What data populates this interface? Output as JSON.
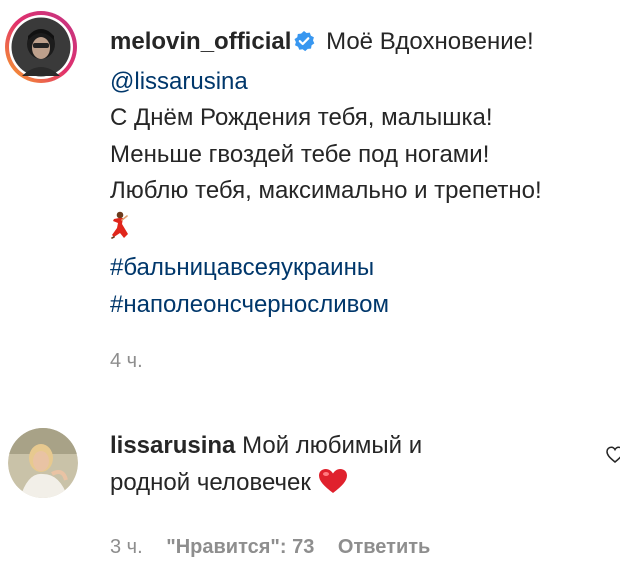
{
  "post": {
    "username": "melovin_official",
    "caption_title": "Моё Вдохновение!",
    "mention": "@lissarusina",
    "lines": [
      "С Днём Рождения тебя, малышка!",
      "Меньше гвоздей тебе под ногами!",
      "Люблю тебя, максимально и трепетно!"
    ],
    "emoji_icon": "dancer-emoji-icon",
    "hashtags": [
      "#бальницавсеяукраины",
      "#наполеонсчерносливом"
    ],
    "time": "4 ч."
  },
  "reply": {
    "username": "lissarusina",
    "text_line1": "Мой любимый и",
    "text_line2": "родной человечек",
    "emoji_icon": "red-heart-emoji-icon",
    "time": "3 ч.",
    "likes": "\"Нравится\": 73",
    "reply_action": "Ответить"
  },
  "colors": {
    "text": "#262626",
    "link": "#00376b",
    "secondary": "#8e8e8e",
    "verified": "#3897f0",
    "heart": "#ed4956"
  }
}
